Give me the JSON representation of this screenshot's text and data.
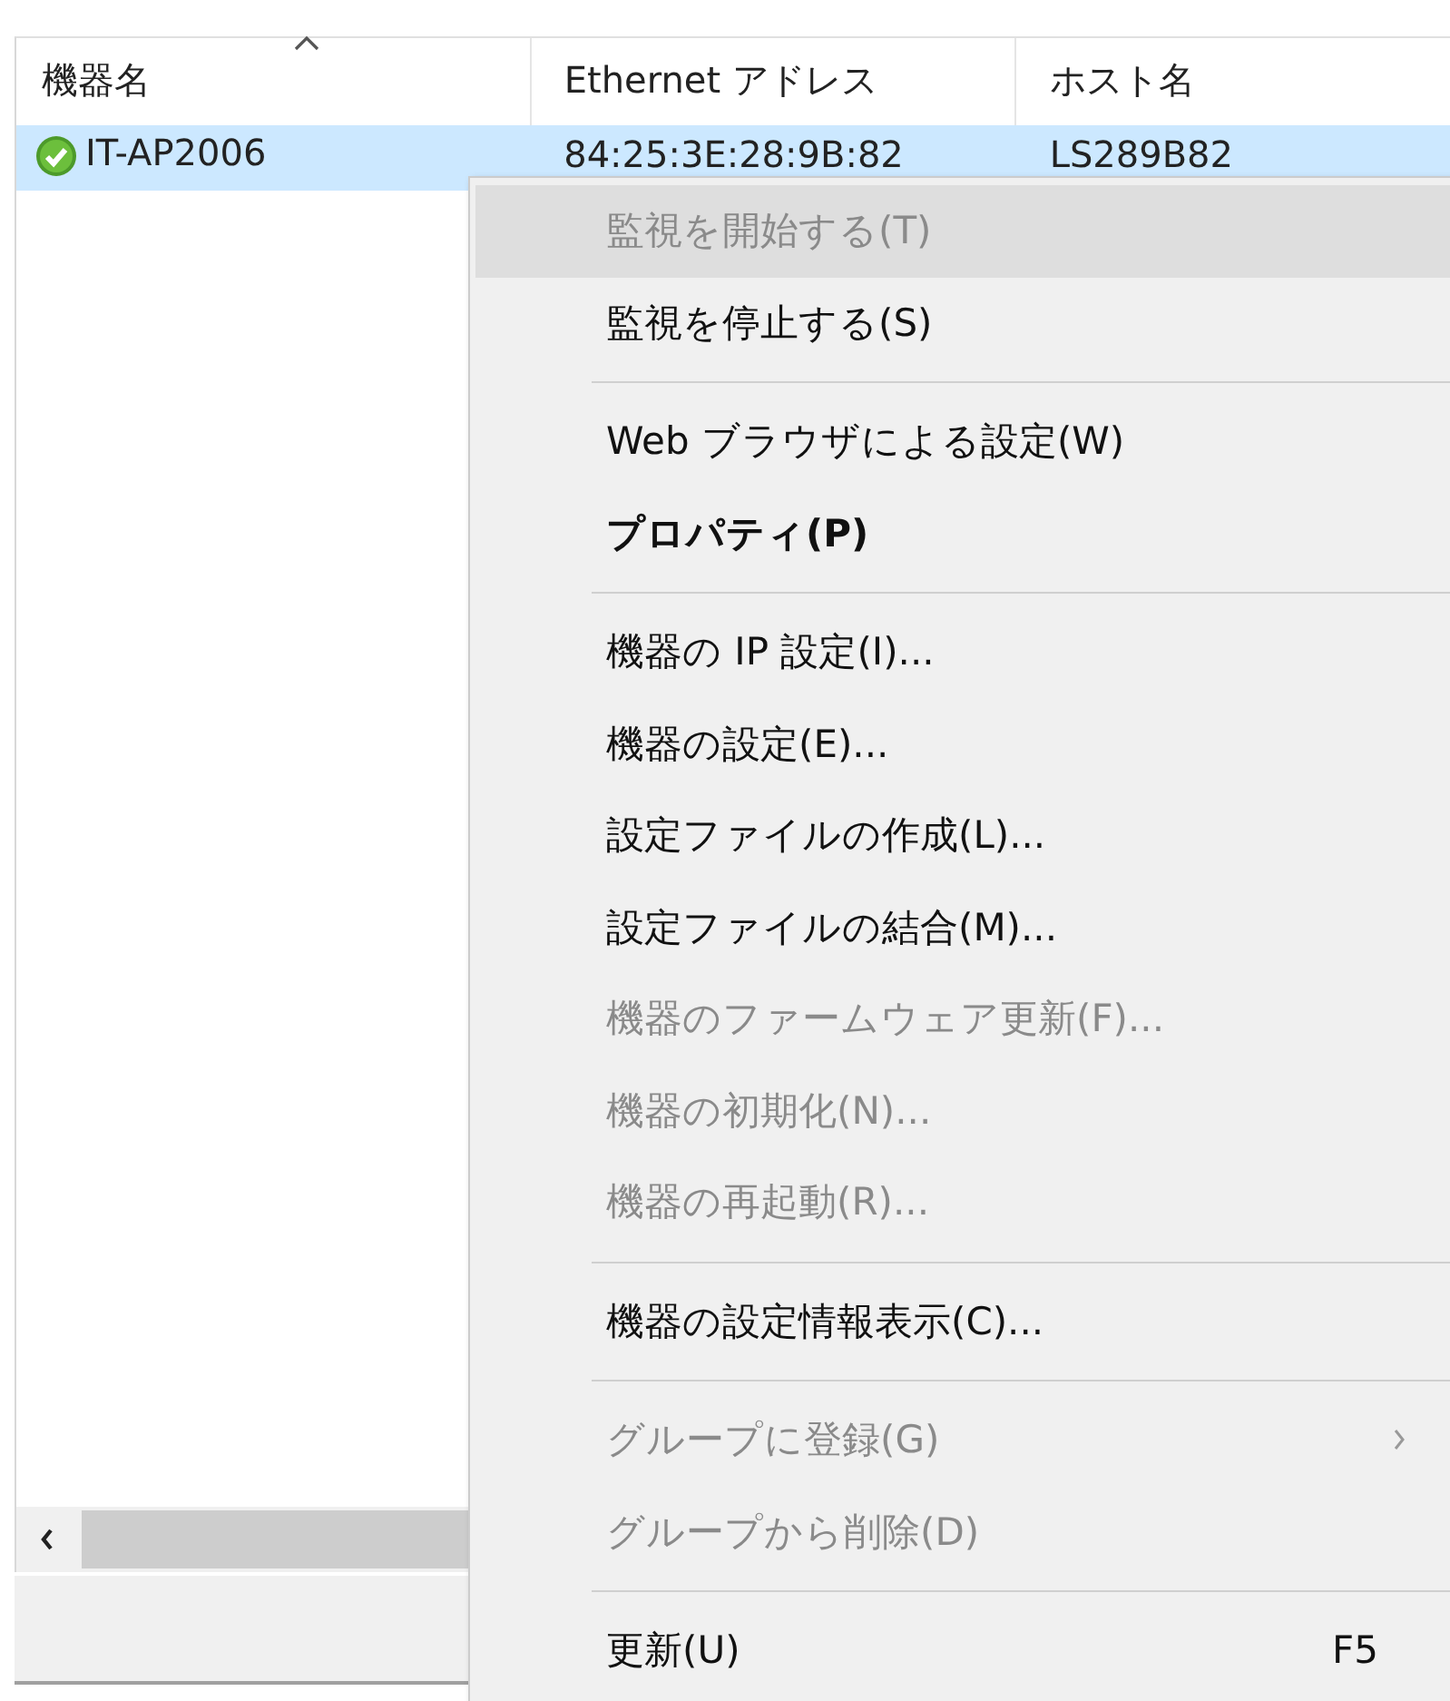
{
  "list": {
    "columns": [
      {
        "label": "機器名",
        "sorted": true
      },
      {
        "label": "Ethernet アドレス",
        "sorted": false
      },
      {
        "label": "ホスト名",
        "sorted": false
      }
    ],
    "rows": [
      {
        "selected": true,
        "ok": true,
        "cells": [
          "IT-AP2006",
          "84:25:3E:28:9B:82",
          "LS289B82"
        ]
      }
    ]
  },
  "context_menu": {
    "items": [
      {
        "kind": "item",
        "label": "監視を開始する(T)",
        "disabled": true,
        "highlighted": true
      },
      {
        "kind": "item",
        "label": "監視を停止する(S)",
        "disabled": false,
        "highlighted": false
      },
      {
        "kind": "separator"
      },
      {
        "kind": "item",
        "label": "Web ブラウザによる設定(W)",
        "disabled": false,
        "highlighted": false
      },
      {
        "kind": "item",
        "label": "プロパティ(P)",
        "disabled": false,
        "highlighted": false,
        "default": true
      },
      {
        "kind": "separator"
      },
      {
        "kind": "item",
        "label": "機器の IP 設定(I)...",
        "disabled": false,
        "highlighted": false
      },
      {
        "kind": "item",
        "label": "機器の設定(E)...",
        "disabled": false,
        "highlighted": false
      },
      {
        "kind": "item",
        "label": "設定ファイルの作成(L)...",
        "disabled": false,
        "highlighted": false
      },
      {
        "kind": "item",
        "label": "設定ファイルの結合(M)...",
        "disabled": false,
        "highlighted": false
      },
      {
        "kind": "item",
        "label": "機器のファームウェア更新(F)...",
        "disabled": true,
        "highlighted": false
      },
      {
        "kind": "item",
        "label": "機器の初期化(N)...",
        "disabled": true,
        "highlighted": false
      },
      {
        "kind": "item",
        "label": "機器の再起動(R)...",
        "disabled": true,
        "highlighted": false
      },
      {
        "kind": "separator"
      },
      {
        "kind": "item",
        "label": "機器の設定情報表示(C)...",
        "disabled": false,
        "highlighted": false
      },
      {
        "kind": "separator"
      },
      {
        "kind": "item",
        "label": "グループに登録(G)",
        "disabled": true,
        "highlighted": false,
        "submenu": true
      },
      {
        "kind": "item",
        "label": "グループから削除(D)",
        "disabled": true,
        "highlighted": false
      },
      {
        "kind": "separator"
      },
      {
        "kind": "item",
        "label": "更新(U)",
        "disabled": false,
        "highlighted": false,
        "shortcut": "F5"
      }
    ]
  }
}
